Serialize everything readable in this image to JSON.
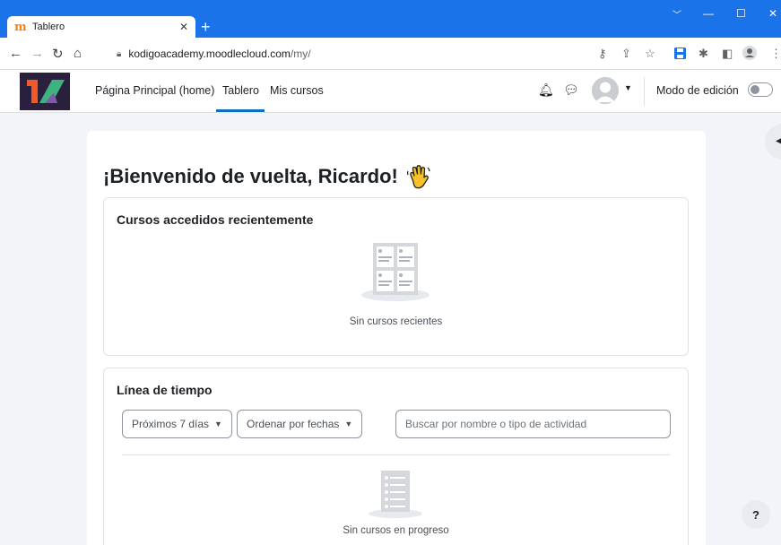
{
  "browser": {
    "tab_title": "Tablero",
    "tab_favicon": "m",
    "tab_close": "✕",
    "new_tab": "+",
    "url_host": "kodigoacademy.moodlecloud.com",
    "url_path": "/my/",
    "window": {
      "minimize": "—",
      "maximize": "☐",
      "close": "✕"
    }
  },
  "nav": {
    "links": [
      "Página Principal (home)",
      "Tablero",
      "Mis cursos"
    ],
    "active_index": 1,
    "edit_mode_label": "Modo de edición",
    "edit_mode_on": false
  },
  "main": {
    "welcome": "¡Bienvenido de vuelta, Ricardo!",
    "recent": {
      "title": "Cursos accedidos recientemente",
      "empty_text": "Sin cursos recientes"
    },
    "timeline": {
      "title": "Línea de tiempo",
      "filter_days": "Próximos 7 días",
      "sort_label": "Ordenar por fechas",
      "search_placeholder": "Buscar por nombre o tipo de actividad",
      "empty_text": "Sin cursos en progreso"
    }
  },
  "help_label": "?",
  "colors": {
    "chrome_blue": "#1a73e8",
    "moodle_blue": "#0f6cbf",
    "page_bg": "#f1f4f9",
    "logo_orange": "#f15a24",
    "logo_green": "#3fb37f"
  }
}
